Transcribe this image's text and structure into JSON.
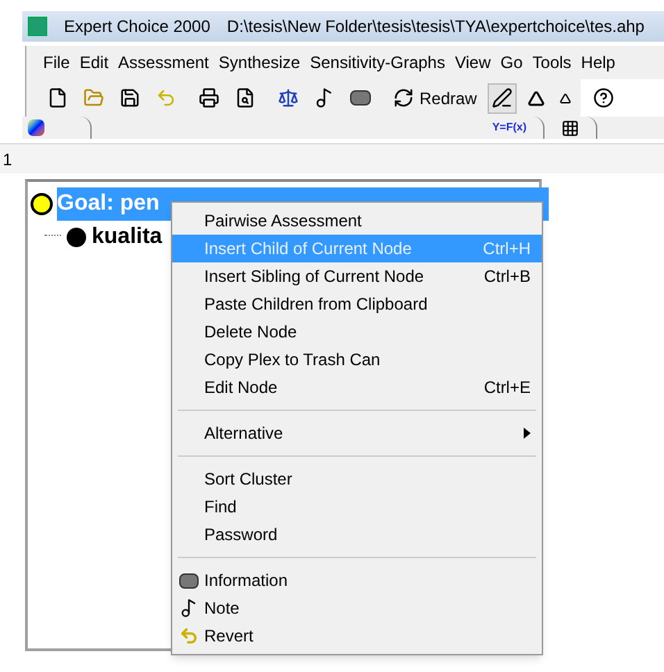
{
  "window": {
    "title": "Expert Choice 2000",
    "file_path": "D:\\tesis\\New Folder\\tesis\\tesis\\TYA\\expertchoice\\tes.ahp"
  },
  "menu": [
    "File",
    "Edit",
    "Assessment",
    "Synthesize",
    "Sensitivity-Graphs",
    "View",
    "Go",
    "Tools",
    "Help"
  ],
  "toolbar": [
    {
      "kind": "new",
      "pressed": false
    },
    {
      "kind": "open",
      "pressed": false
    },
    {
      "kind": "save",
      "pressed": false
    },
    {
      "kind": "revert",
      "pressed": false
    },
    {
      "kind": "separator"
    },
    {
      "kind": "print",
      "pressed": false
    },
    {
      "kind": "preview",
      "pressed": false
    },
    {
      "kind": "separator"
    },
    {
      "kind": "scale",
      "pressed": false
    },
    {
      "kind": "note",
      "pressed": false
    },
    {
      "kind": "info",
      "pressed": false
    },
    {
      "kind": "separator"
    },
    {
      "kind": "redraw",
      "label": "Redraw",
      "pressed": false
    },
    {
      "kind": "pen",
      "pressed": true
    },
    {
      "kind": "font-up",
      "pressed": false
    },
    {
      "kind": "font-down",
      "pressed": false
    },
    {
      "kind": "separator"
    },
    {
      "kind": "help",
      "pressed": false
    }
  ],
  "tabs_left": [
    {
      "kind": "hierarchy",
      "selected": true
    }
  ],
  "tabs_right": [
    {
      "kind": "formula",
      "label": "Y=F(x)",
      "selected": false
    },
    {
      "kind": "grid",
      "selected": false
    }
  ],
  "node_field": {
    "value": "1"
  },
  "tree": [
    {
      "label": "Goal: pen",
      "selected": true,
      "color": "#ffff00",
      "children": [
        {
          "label": "kualita",
          "selected": false,
          "color": "#000000"
        }
      ]
    }
  ],
  "context_menu": [
    {
      "kind": "item",
      "label": "Pairwise Assessment",
      "selected": false
    },
    {
      "kind": "item",
      "label": "Insert Child of Current Node",
      "shortcut": "Ctrl+H",
      "selected": true
    },
    {
      "kind": "item",
      "label": "Insert Sibling of Current Node",
      "shortcut": "Ctrl+B",
      "selected": false
    },
    {
      "kind": "item",
      "label": "Paste Children from Clipboard",
      "selected": false
    },
    {
      "kind": "item",
      "label": "Delete Node",
      "selected": false
    },
    {
      "kind": "item",
      "label": "Copy Plex to Trash Can",
      "selected": false
    },
    {
      "kind": "item",
      "label": "Edit Node",
      "shortcut": "Ctrl+E",
      "selected": false
    },
    {
      "kind": "separator"
    },
    {
      "kind": "submenu",
      "label": "Alternative",
      "selected": false
    },
    {
      "kind": "separator"
    },
    {
      "kind": "item",
      "label": "Sort Cluster",
      "selected": false
    },
    {
      "kind": "item",
      "label": "Find",
      "selected": false
    },
    {
      "kind": "item",
      "label": "Password",
      "selected": false
    },
    {
      "kind": "separator"
    },
    {
      "kind": "info",
      "label": "Information",
      "selected": false
    },
    {
      "kind": "note",
      "label": "Note",
      "selected": false
    },
    {
      "kind": "revert",
      "label": "Revert",
      "selected": false
    }
  ]
}
